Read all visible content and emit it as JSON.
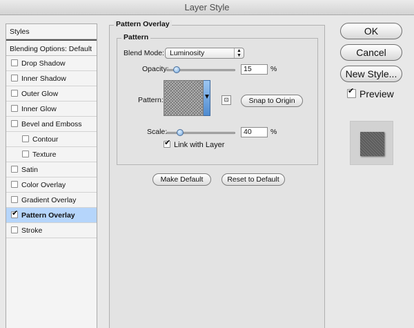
{
  "window": {
    "title": "Layer Style"
  },
  "sidebar": {
    "header": "Styles",
    "blending": "Blending Options: Default",
    "items": [
      {
        "label": "Drop Shadow",
        "checked": false,
        "indent": false,
        "selected": false
      },
      {
        "label": "Inner Shadow",
        "checked": false,
        "indent": false,
        "selected": false
      },
      {
        "label": "Outer Glow",
        "checked": false,
        "indent": false,
        "selected": false
      },
      {
        "label": "Inner Glow",
        "checked": false,
        "indent": false,
        "selected": false
      },
      {
        "label": "Bevel and Emboss",
        "checked": false,
        "indent": false,
        "selected": false
      },
      {
        "label": "Contour",
        "checked": false,
        "indent": true,
        "selected": false
      },
      {
        "label": "Texture",
        "checked": false,
        "indent": true,
        "selected": false
      },
      {
        "label": "Satin",
        "checked": false,
        "indent": false,
        "selected": false
      },
      {
        "label": "Color Overlay",
        "checked": false,
        "indent": false,
        "selected": false
      },
      {
        "label": "Gradient Overlay",
        "checked": false,
        "indent": false,
        "selected": false
      },
      {
        "label": "Pattern Overlay",
        "checked": true,
        "indent": false,
        "selected": true
      },
      {
        "label": "Stroke",
        "checked": false,
        "indent": false,
        "selected": false
      }
    ]
  },
  "panel": {
    "title": "Pattern Overlay",
    "subgroup_title": "Pattern",
    "blend_mode_label": "Blend Mode:",
    "blend_mode_value": "Luminosity",
    "opacity_label": "Opacity:",
    "opacity_value": "15",
    "opacity_level": 0.15,
    "opacity_unit": "%",
    "pattern_label": "Pattern:",
    "snap_button": "Snap to Origin",
    "scale_label": "Scale:",
    "scale_value": "40",
    "scale_level": 0.2,
    "scale_unit": "%",
    "link_label": "Link with Layer",
    "link_checked": true,
    "make_default": "Make Default",
    "reset_default": "Reset to Default"
  },
  "actions": {
    "ok": "OK",
    "cancel": "Cancel",
    "new_style": "New Style...",
    "preview_label": "Preview",
    "preview_checked": true
  }
}
